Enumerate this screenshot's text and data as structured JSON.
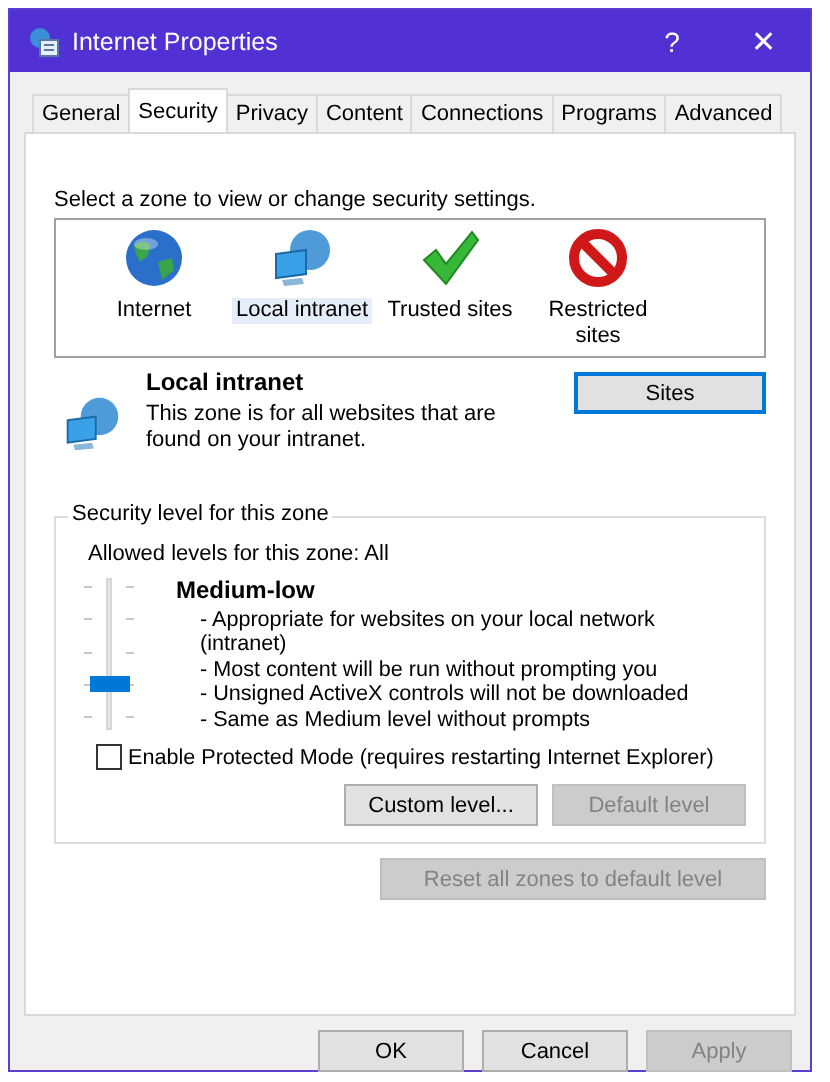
{
  "window": {
    "title": "Internet Properties",
    "help": "?",
    "close": "✕"
  },
  "tabs": [
    {
      "label": "General",
      "selected": false
    },
    {
      "label": "Security",
      "selected": true
    },
    {
      "label": "Privacy",
      "selected": false
    },
    {
      "label": "Content",
      "selected": false
    },
    {
      "label": "Connections",
      "selected": false
    },
    {
      "label": "Programs",
      "selected": false
    },
    {
      "label": "Advanced",
      "selected": false
    }
  ],
  "zone_prompt": "Select a zone to view or change security settings.",
  "zones": [
    {
      "kind": "globe",
      "label": "Internet",
      "selected": false
    },
    {
      "kind": "intranet",
      "label": "Local intranet",
      "selected": true
    },
    {
      "kind": "check",
      "label": "Trusted sites",
      "selected": false
    },
    {
      "kind": "blocked",
      "label": "Restricted sites",
      "selected": false
    }
  ],
  "zone_info": {
    "title": "Local intranet",
    "description": "This zone is for all websites that are found on your intranet.",
    "sites_button": {
      "label": "Sites",
      "focused": true
    }
  },
  "security_level": {
    "legend": "Security level for this zone",
    "allowed": "Allowed levels for this zone: All",
    "level": 0.25,
    "level_name": "Medium-low",
    "details": [
      "- Appropriate for websites on your local network (intranet)",
      "- Most content will be run without prompting you",
      "- Unsigned ActiveX controls will not be downloaded",
      "- Same as Medium level without prompts"
    ],
    "protected_mode": {
      "label": "Enable Protected Mode (requires restarting Internet Explorer)",
      "checked": false
    },
    "buttons": [
      {
        "label": "Custom level...",
        "disabled": false
      },
      {
        "label": "Default level",
        "disabled": true
      }
    ]
  },
  "reset_button": {
    "label": "Reset all zones to default level",
    "disabled": true
  },
  "footer_buttons": [
    {
      "label": "OK",
      "disabled": false
    },
    {
      "label": "Cancel",
      "disabled": false
    },
    {
      "label": "Apply",
      "disabled": true
    }
  ]
}
